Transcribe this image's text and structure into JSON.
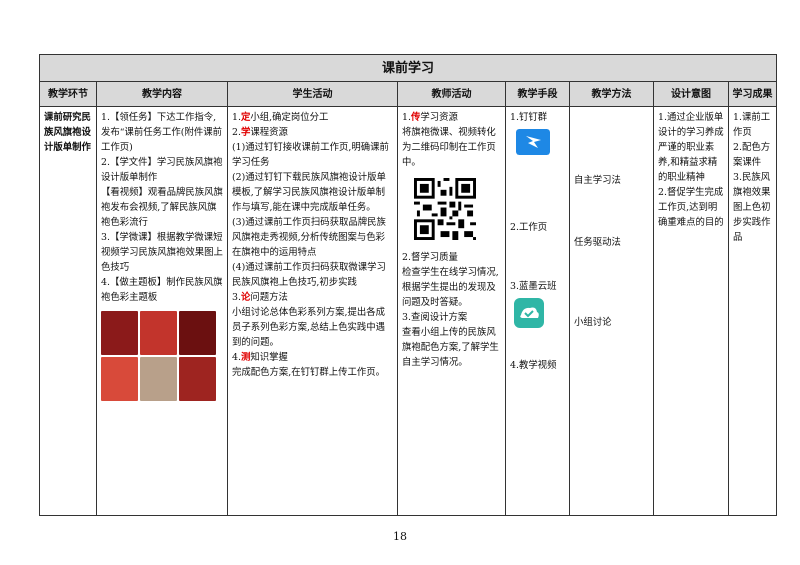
{
  "section_title": "课前学习",
  "headers": [
    "教学环节",
    "教学内容",
    "学生活动",
    "教师活动",
    "教学手段",
    "教学方法",
    "设计意图",
    "学习成果"
  ],
  "stage": "课前研究民族风旗袍设计版单制作",
  "content": [
    "1.【领任务】下达工作指令,发布“课前任务工作(附件课前工作页)",
    "2.【学文件】学习民族风旗袍设计版单制作",
    "【看视频】观看品牌民族风旗袍发布会视频,了解民族风旗袍色彩流行",
    "3.【学微课】根据教学微课短视频学习民族风旗袍效果图上色技巧",
    "4.【做主题板】制作民族风旗袍色彩主题板"
  ],
  "student": {
    "s1_num": "1.",
    "s1_mark": "定",
    "s1_text": "小组,确定岗位分工",
    "s2_num": "2.",
    "s2_mark": "学",
    "s2_text": "课程资源",
    "s2_a": "(1)通过钉钉接收课前工作页,明确课前学习任务",
    "s2_b": "(2)通过钉钉下载民族风旗袍设计版单模板,了解学习民族风旗袍设计版单制作与填写,能在课中完成版单任务。",
    "s2_c": "(3)通过课前工作页扫码获取品牌民族风旗袍走秀视频,分析传统图案与色彩在旗袍中的运用特点",
    "s2_d": "(4)通过课前工作页扫码获取微课学习民族风旗袍上色技巧,初步实践",
    "s3_num": "3.",
    "s3_mark": "论",
    "s3_text": "问题方法",
    "s3_a": "小组讨论总体色彩系列方案,提出各成员子系列色彩方案,总结上色实践中遇到的问题。",
    "s4_num": "4.",
    "s4_mark": "测",
    "s4_text": "知识掌握",
    "s4_a": "完成配色方案,在钉钉群上传工作页。"
  },
  "teacher": {
    "t1_num": "1.",
    "t1_mark": "传",
    "t1_text": "学习资源",
    "t1_a": "将旗袍微课、视频转化为二维码印制在工作页中。",
    "t2": "2.督学习质量",
    "t2_a": "检查学生在线学习情况,根据学生提出的发现及问题及时答疑。",
    "t3": "3.查阅设计方案",
    "t3_a": "查看小组上传的民族风旗袍配色方案,了解学生自主学习情况。"
  },
  "means": [
    "1.钉钉群",
    "2.工作页",
    "3.蓝墨云班",
    "4.教学视频"
  ],
  "methods": [
    "自主学习法",
    "任务驱动法",
    "小组讨论"
  ],
  "intent": [
    "1.通过企业版单设计的学习养成严谨的职业素养,和精益求精的职业精神",
    "2.督促学生完成工作页,达到明确重难点的目的"
  ],
  "outcomes": [
    "1.课前工作页",
    "2.配色方案课件",
    "3.民族风旗袍效果图上色初步实践作品"
  ],
  "page_number": "18",
  "colors": {
    "header_bg": "#d9d9d9",
    "accent_red": "#e00000"
  },
  "icons": [
    "qr-code-icon",
    "dingtalk-icon",
    "mosoteach-icon",
    "photo-collage"
  ]
}
